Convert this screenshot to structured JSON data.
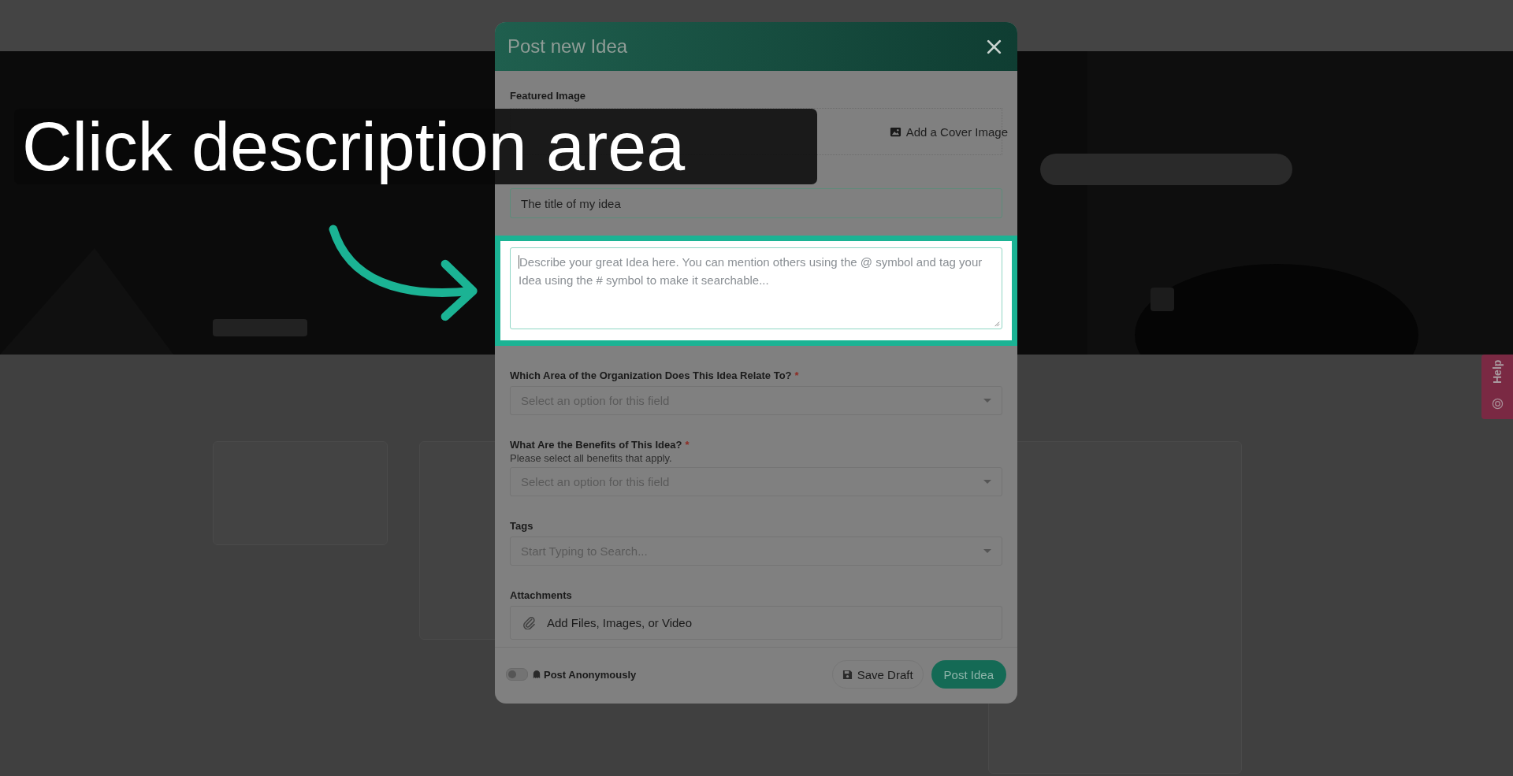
{
  "tutorial": {
    "caption": "Click description area"
  },
  "modal": {
    "title": "Post new Idea",
    "featured_image": {
      "label": "Featured Image",
      "button": "Add a Cover Image"
    },
    "title_field": {
      "placeholder": "The title of my idea"
    },
    "description": {
      "placeholder": "Describe your great Idea here. You can mention others using the @ symbol and tag your Idea using the # symbol to make it searchable..."
    },
    "fields": [
      {
        "label": "Which Area of the Organization Does This Idea Relate To?",
        "required_mark": "*",
        "placeholder": "Select an option for this field"
      },
      {
        "label": "What Are the Benefits of This Idea?",
        "required_mark": "*",
        "hint": "Please select all benefits that apply.",
        "placeholder": "Select an option for this field"
      },
      {
        "label": "Tags",
        "placeholder": "Start Typing to Search..."
      }
    ],
    "attachments": {
      "label": "Attachments",
      "button": "Add Files, Images, or Video"
    },
    "footer": {
      "anonymous": {
        "label": "Post Anonymously",
        "on": false
      },
      "save_button": "Save Draft",
      "post_button": "Post Idea"
    }
  },
  "help_tab": {
    "label": "Help"
  }
}
